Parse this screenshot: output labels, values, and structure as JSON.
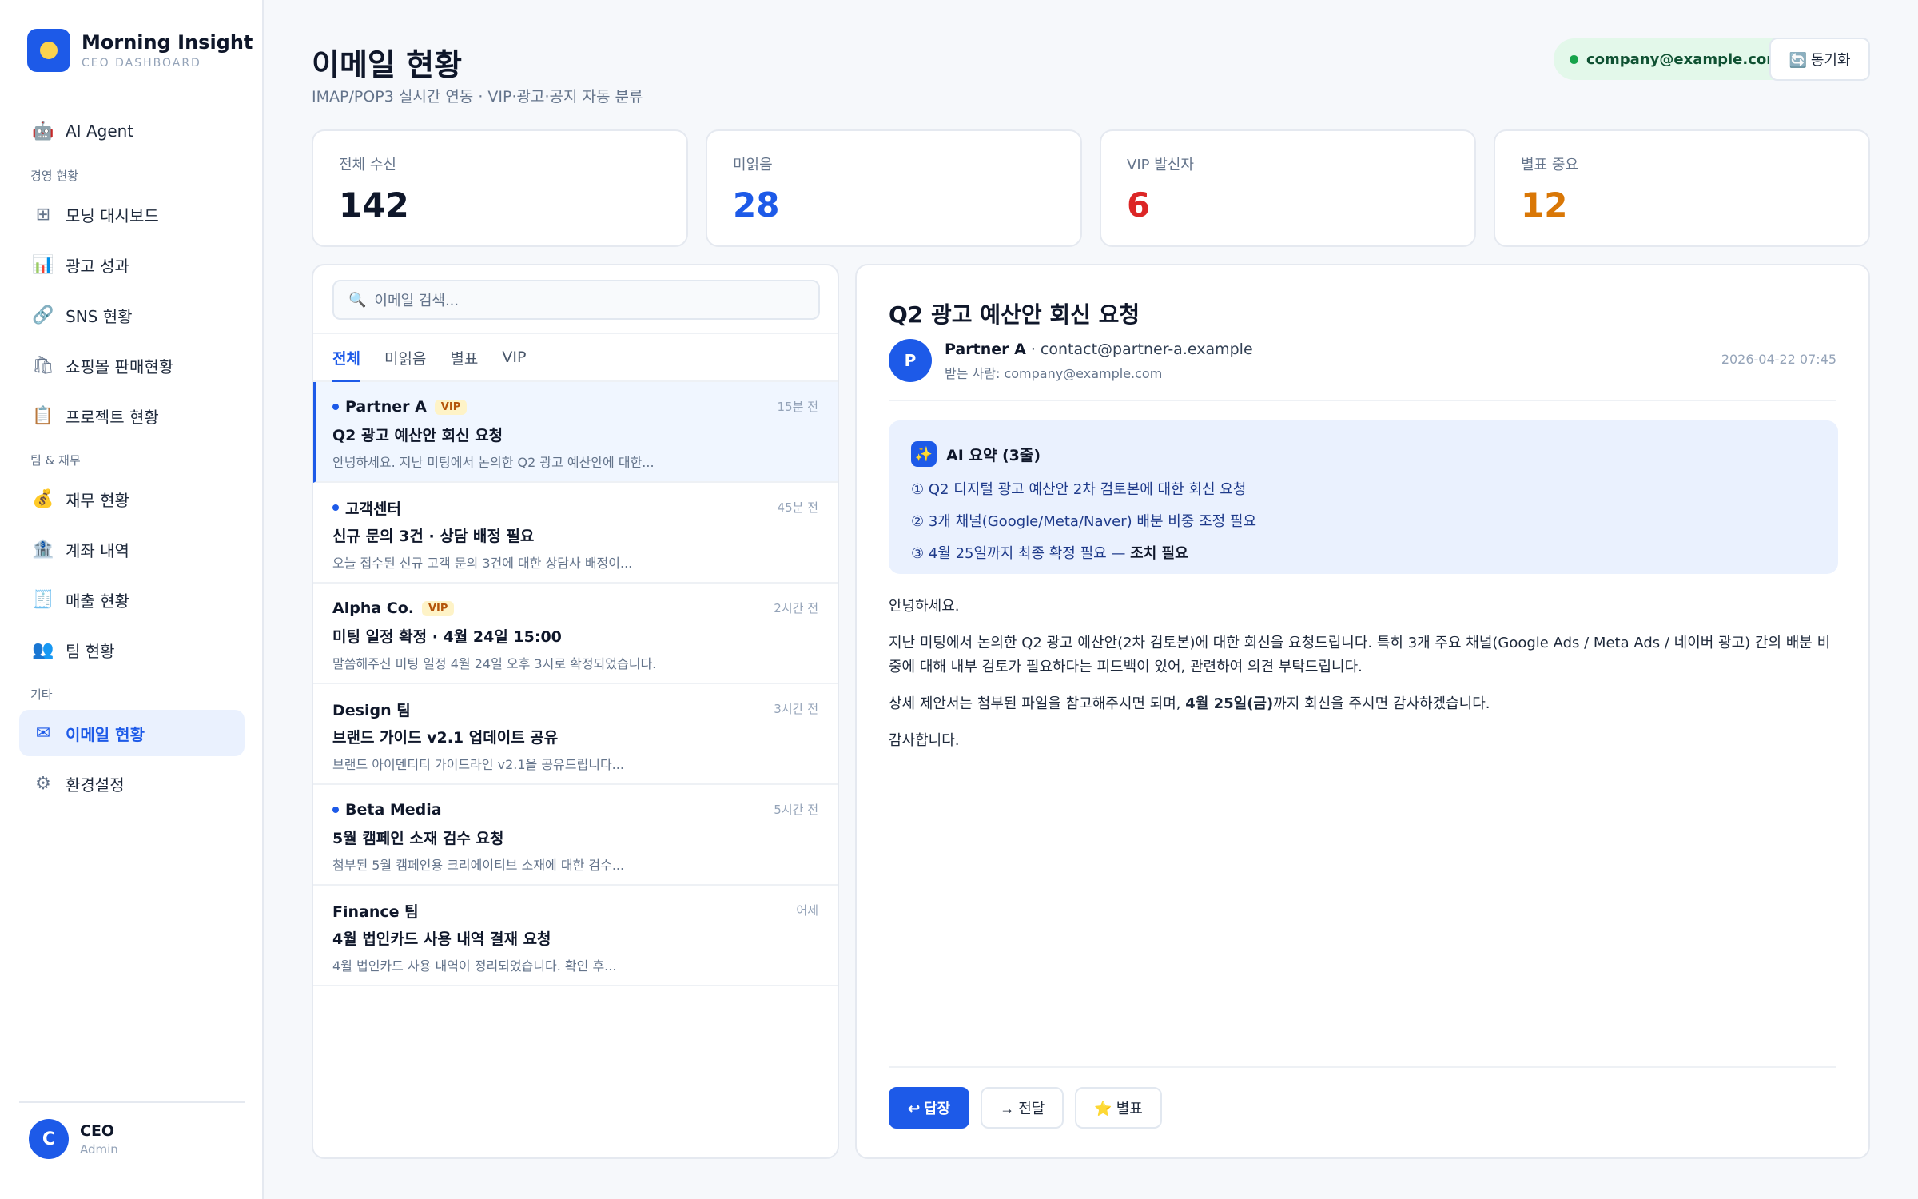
{
  "brand": {
    "name": "Morning Insight",
    "sub": "CEO DASHBOARD"
  },
  "sidebar": {
    "top": [
      {
        "icon": "🤖",
        "label": "AI Agent"
      }
    ],
    "sections": [
      {
        "title": "경영 현황",
        "items": [
          {
            "icon": "⊞",
            "label": "모닝 대시보드"
          },
          {
            "icon": "📊",
            "label": "광고 성과"
          },
          {
            "icon": "🔗",
            "label": "SNS 현황"
          },
          {
            "icon": "🛍",
            "label": "쇼핑몰 판매현황"
          },
          {
            "icon": "📋",
            "label": "프로젝트 현황"
          }
        ]
      },
      {
        "title": "팀 & 재무",
        "items": [
          {
            "icon": "💰",
            "label": "재무 현황"
          },
          {
            "icon": "🏦",
            "label": "계좌 내역"
          },
          {
            "icon": "🧾",
            "label": "매출 현황"
          },
          {
            "icon": "👥",
            "label": "팀 현황"
          }
        ]
      },
      {
        "title": "기타",
        "items": [
          {
            "icon": "✉",
            "label": "이메일 현황",
            "active": true
          },
          {
            "icon": "⚙",
            "label": "환경설정"
          }
        ]
      }
    ],
    "user": {
      "initial": "C",
      "name": "CEO",
      "role": "Admin"
    }
  },
  "header": {
    "title": "이메일 현황",
    "subtitle": "IMAP/POP3 실시간 연동 · VIP·광고·공지 자동 분류",
    "account": "company@example.com",
    "sync_label": "🔄 동기화"
  },
  "stats": [
    {
      "label": "전체 수신",
      "value": "142",
      "color": "#0f172a"
    },
    {
      "label": "미읽음",
      "value": "28",
      "color": "#1d5ae8"
    },
    {
      "label": "VIP 발신자",
      "value": "6",
      "color": "#dc2626"
    },
    {
      "label": "별표 중요",
      "value": "12",
      "color": "#d97706"
    }
  ],
  "list": {
    "search_placeholder": "이메일 검색...",
    "tabs": [
      "전체",
      "미읽음",
      "별표",
      "VIP"
    ],
    "emails": [
      {
        "sender": "Partner A",
        "vip": "VIP",
        "unread": true,
        "time": "15분 전",
        "subject": "Q2 광고 예산안 회신 요청",
        "preview": "안녕하세요. 지난 미팅에서 논의한 Q2 광고 예산안에 대한...",
        "selected": true
      },
      {
        "sender": "고객센터",
        "vip": "",
        "unread": true,
        "time": "45분 전",
        "subject": "신규 문의 3건 · 상담 배정 필요",
        "preview": "오늘 접수된 신규 고객 문의 3건에 대한 상담사 배정이..."
      },
      {
        "sender": "Alpha Co.",
        "vip": "VIP",
        "unread": false,
        "time": "2시간 전",
        "subject": "미팅 일정 확정 · 4월 24일 15:00",
        "preview": "말씀해주신 미팅 일정 4월 24일 오후 3시로 확정되었습니다."
      },
      {
        "sender": "Design 팀",
        "vip": "",
        "unread": false,
        "time": "3시간 전",
        "subject": "브랜드 가이드 v2.1 업데이트 공유",
        "preview": "브랜드 아이덴티티 가이드라인 v2.1을 공유드립니다..."
      },
      {
        "sender": "Beta Media",
        "vip": "",
        "unread": true,
        "time": "5시간 전",
        "subject": "5월 캠페인 소재 검수 요청",
        "preview": "첨부된 5월 캠페인용 크리에이티브 소재에 대한 검수..."
      },
      {
        "sender": "Finance 팀",
        "vip": "",
        "unread": false,
        "time": "어제",
        "subject": "4월 법인카드 사용 내역 결재 요청",
        "preview": "4월 법인카드 사용 내역이 정리되었습니다. 확인 후..."
      }
    ]
  },
  "detail": {
    "subject": "Q2 광고 예산안 회신 요청",
    "avatar": "P",
    "from_name": "Partner A",
    "from_email": "· contact@partner-a.example",
    "to": "받는 사람: company@example.com",
    "date": "2026-04-22 07:45",
    "ai_title": "AI 요약 (3줄)",
    "ai_icon": "✨",
    "ai_lines": [
      "① Q2 디지털 광고 예산안 2차 검토본에 대한 회신 요청",
      "② 3개 채널(Google/Meta/Naver) 배분 비중 조정 필요",
      "③ 4월 25일까지 최종 확정 필요 — "
    ],
    "ai_emphasis": "조치 필요",
    "body": [
      "안녕하세요.",
      "지난 미팅에서 논의한 Q2 광고 예산안(2차 검토본)에 대한 회신을 요청드립니다. 특히 3개 주요 채널(Google Ads / Meta Ads / 네이버 광고) 간의 배분 비중에 대해 내부 검토가 필요하다는 피드백이 있어, 관련하여 의견 부탁드립니다.",
      "",
      "감사합니다."
    ],
    "body_p3_before": "상세 제안서는 첨부된 파일을 참고해주시면 되며, ",
    "body_p3_bold": "4월 25일(금)",
    "body_p3_after": "까지 회신을 주시면 감사하겠습니다.",
    "actions": {
      "reply": "↩ 답장",
      "forward": "→ 전달",
      "star": "⭐ 별표"
    }
  }
}
